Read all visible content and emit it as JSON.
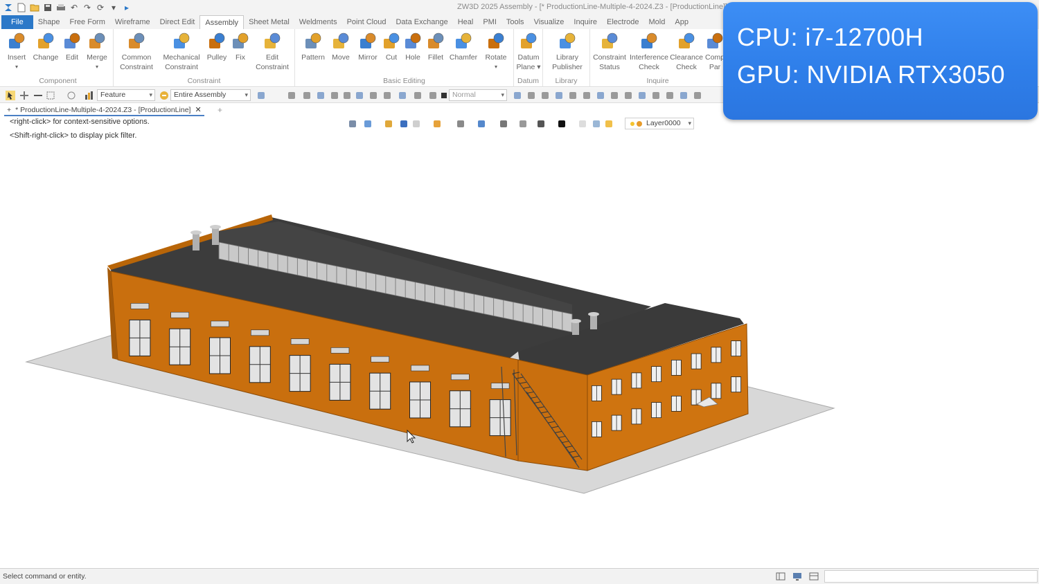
{
  "window": {
    "title": "ZW3D 2025   Assembly - [* ProductionLine-Multiple-4-2024.Z3 - [ProductionLine]]"
  },
  "quick_access": [
    "app-icon",
    "new-icon",
    "open-icon",
    "save-icon",
    "print-icon",
    "undo-icon",
    "redo-icon",
    "regen-icon",
    "dropdown-icon",
    "play-icon"
  ],
  "menu": {
    "file": "File",
    "tabs": [
      "Shape",
      "Free Form",
      "Wireframe",
      "Direct Edit",
      "Assembly",
      "Sheet Metal",
      "Weldments",
      "Point Cloud",
      "Data Exchange",
      "Heal",
      "PMI",
      "Tools",
      "Visualize",
      "Inquire",
      "Electrode",
      "Mold",
      "App"
    ],
    "active": "Assembly"
  },
  "ribbon": {
    "groups": [
      {
        "label": "Component",
        "buttons": [
          {
            "label": "Insert",
            "icon": "insert-icon",
            "dropdown": true
          },
          {
            "label": "Change",
            "icon": "change-icon"
          },
          {
            "label": "Edit",
            "icon": "edit-icon"
          },
          {
            "label": "Merge",
            "icon": "merge-icon",
            "dropdown": true
          }
        ]
      },
      {
        "label": "Constraint",
        "buttons": [
          {
            "label": "Common\nConstraint",
            "icon": "common-constraint-icon"
          },
          {
            "label": "Mechanical\nConstraint",
            "icon": "mechanical-constraint-icon"
          },
          {
            "label": "Pulley",
            "icon": "pulley-icon"
          },
          {
            "label": "Fix",
            "icon": "fix-icon"
          },
          {
            "label": "Edit\nConstraint",
            "icon": "edit-constraint-icon"
          }
        ]
      },
      {
        "label": "Basic Editing",
        "buttons": [
          {
            "label": "Pattern",
            "icon": "pattern-icon"
          },
          {
            "label": "Move",
            "icon": "move-icon"
          },
          {
            "label": "Mirror",
            "icon": "mirror-icon"
          },
          {
            "label": "Cut",
            "icon": "cut-icon"
          },
          {
            "label": "Hole",
            "icon": "hole-icon"
          },
          {
            "label": "Fillet",
            "icon": "fillet-icon"
          },
          {
            "label": "Chamfer",
            "icon": "chamfer-icon"
          },
          {
            "label": "Rotate",
            "icon": "rotate-icon",
            "dropdown": true
          }
        ]
      },
      {
        "label": "Datum",
        "buttons": [
          {
            "label": "Datum\nPlane ▾",
            "icon": "datum-plane-icon"
          }
        ]
      },
      {
        "label": "Library",
        "buttons": [
          {
            "label": "Library\nPublisher",
            "icon": "library-publisher-icon"
          }
        ]
      },
      {
        "label": "Inquire",
        "buttons": [
          {
            "label": "Constraint\nStatus",
            "icon": "constraint-status-icon"
          },
          {
            "label": "Interference\nCheck",
            "icon": "interference-check-icon"
          },
          {
            "label": "Clearance\nCheck",
            "icon": "clearance-check-icon"
          },
          {
            "label": "Comp\nPar",
            "icon": "component-icon"
          }
        ]
      }
    ]
  },
  "toolbar2": {
    "filter_value": "Feature",
    "scope_value": "Entire Assembly",
    "style_value": "Normal"
  },
  "document": {
    "tab_label": "* ProductionLine-Multiple-4-2024.Z3 - [ProductionLine]",
    "close": "✕",
    "add": "+",
    "pin": "+"
  },
  "viewport": {
    "hint1": "<right-click>  for context-sensitive options.",
    "hint2": "<Shift-right-click>  to display pick filter.",
    "layer": "Layer0000"
  },
  "status": {
    "text": "Select command or entity."
  },
  "overlay": {
    "cpu": "CPU: i7-12700H",
    "gpu": "GPU:  NVIDIA RTX3050"
  },
  "colors": {
    "brick": "#c96f0e",
    "brick_dark": "#a9590a",
    "roof": "#3b3b3b",
    "ground": "#d9d9d9",
    "accent": "#2b78c8",
    "overlay": "#2f7fea"
  }
}
